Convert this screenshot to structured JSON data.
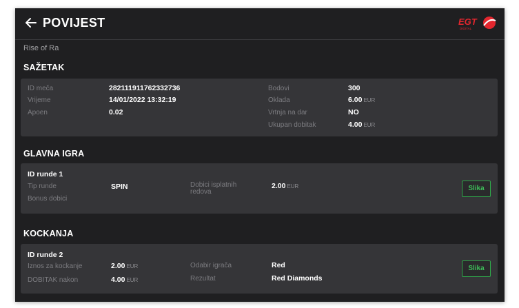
{
  "header": {
    "title": "POVIJEST",
    "back_icon": "arrow-left-icon",
    "logo_text": "EGT",
    "logo_subtext": "DIGITAL",
    "logo_color": "#e3262e"
  },
  "game_name": "Rise of Ra",
  "summary": {
    "title": "SAŽETAK",
    "left": [
      {
        "label": "ID meča",
        "value": "282111911762332736",
        "unit": ""
      },
      {
        "label": "Vrijeme",
        "value": "14/01/2022 13:32:19",
        "unit": ""
      },
      {
        "label": "Apoen",
        "value": "0.02",
        "unit": ""
      }
    ],
    "right": [
      {
        "label": "Bodovi",
        "value": "300",
        "unit": ""
      },
      {
        "label": "Oklada",
        "value": "6.00",
        "unit": "EUR"
      },
      {
        "label": "Vrtnja na dar",
        "value": "NO",
        "unit": ""
      },
      {
        "label": "Ukupan dobitak",
        "value": "4.00",
        "unit": "EUR"
      }
    ]
  },
  "main_game": {
    "title": "GLAVNA IGRA",
    "round_id": "ID runde 1",
    "round_type_label": "Tip runde",
    "round_type_value": "SPIN",
    "bonus_label": "Bonus dobici",
    "lines_label_1": "Dobici isplatnih",
    "lines_label_2": "redova",
    "lines_value": "2.00",
    "lines_unit": "EUR",
    "button": "Slika"
  },
  "gamble": {
    "title": "KOCKANJA",
    "round_id": "ID runde 2",
    "amount_label": "Iznos za kockanje",
    "amount_value": "2.00",
    "amount_unit": "EUR",
    "win_label": "DOBITAK nakon",
    "win_value": "4.00",
    "win_unit": "EUR",
    "choice_label": "Odabir igrača",
    "choice_value": "Red",
    "result_label": "Rezultat",
    "result_value": "Red Diamonds",
    "button": "Slika"
  },
  "colors": {
    "background": "#1f1f21",
    "card": "#353538",
    "accent_green": "#3dbb58"
  }
}
